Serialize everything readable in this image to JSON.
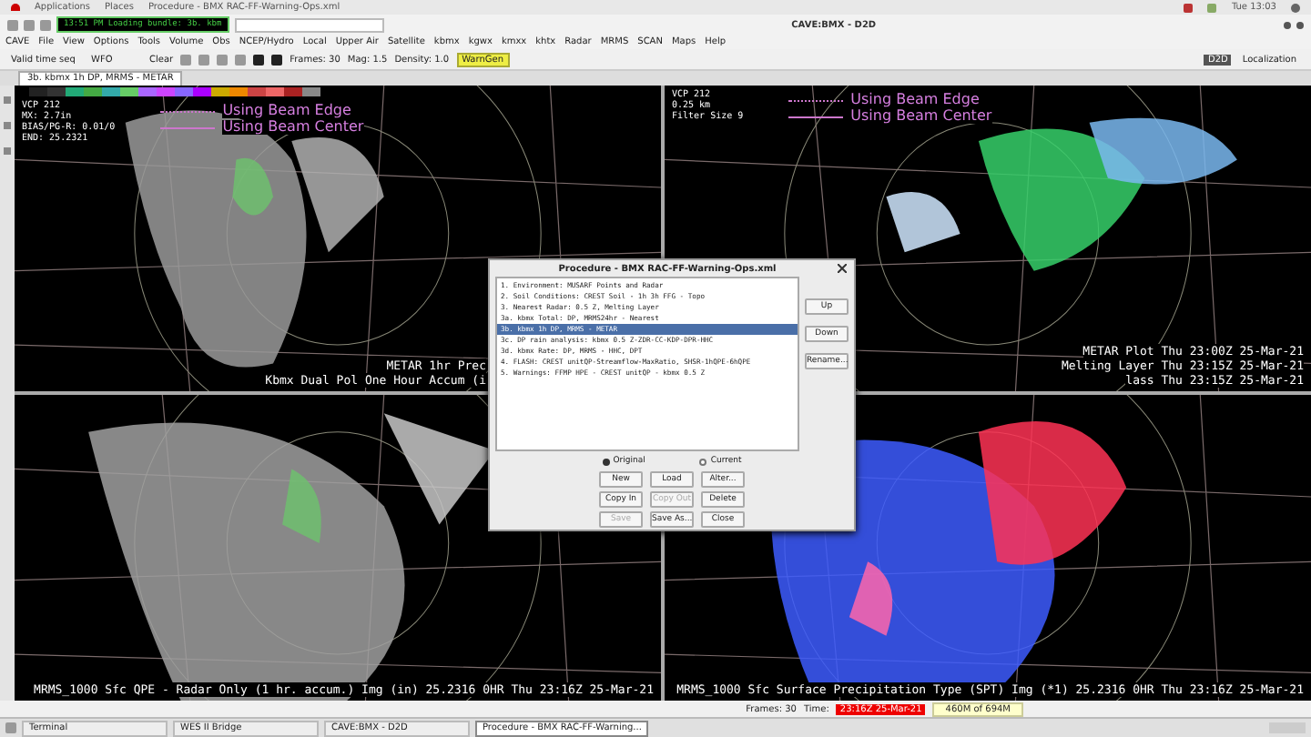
{
  "system_bar": {
    "items": [
      "Applications",
      "Places",
      "Procedure - BMX RAC-FF-Warning-Ops.xml"
    ],
    "clock": "Tue 13:03"
  },
  "window": {
    "title": "CAVE:BMX - D2D",
    "loading_message": "13:51 PM Loading bundle: 3b. kbm"
  },
  "menu": [
    "CAVE",
    "File",
    "View",
    "Options",
    "Tools",
    "Volume",
    "Obs",
    "NCEP/Hydro",
    "Local",
    "Upper Air",
    "Satellite",
    "kbmx",
    "kgwx",
    "kmxx",
    "khtx",
    "Radar",
    "MRMS",
    "SCAN",
    "Maps",
    "Help"
  ],
  "toolbar": {
    "time_mode": "Valid time seq",
    "scale": "WFO",
    "clear": "Clear",
    "frames": "Frames: 30",
    "mag": "Mag: 1.5",
    "density": "Density: 1.0",
    "warngen": "WarnGen",
    "perspectives": [
      {
        "label": "D2D",
        "selected": true
      },
      {
        "label": "Localization",
        "selected": false
      }
    ]
  },
  "editor_tab": "3b. kbmx 1h DP, MRMS - METAR",
  "panels": [
    {
      "kind": "dual-pol-accum",
      "info": [
        "VCP 212",
        "MX: 2.7in",
        "BIAS/PG-R: 0.01/0",
        "END: 25.2321"
      ],
      "legend": [
        "Using Beam Edge",
        "Using Beam Center"
      ],
      "colorbar": true,
      "labels": [
        "METAR 1hr Prec",
        "Kbmx Dual Pol One Hour Accum (i"
      ]
    },
    {
      "kind": "precip-class",
      "info": [
        "VCP 212",
        "0.25 km",
        "Filter Size 9"
      ],
      "legend": [
        "Using Beam Edge",
        "Using Beam Center"
      ],
      "labels": [
        "METAR Plot  Thu 23:00Z 25-Mar-21",
        "Melting Layer  Thu 23:15Z 25-Mar-21",
        "lass  Thu 23:15Z 25-Mar-21"
      ]
    },
    {
      "kind": "mrms-qpe",
      "labels": [
        "MRMS_1000 Sfc QPE - Radar Only (1 hr. accum.) Img (in)   25.2316   0HR Thu 23:16Z 25-Mar-21"
      ]
    },
    {
      "kind": "precip-type",
      "labels": [
        "MRMS_1000 Sfc Surface Precipitation Type (SPT) Img (*1)   25.2316   0HR Thu 23:16Z 25-Mar-21"
      ]
    }
  ],
  "dialog": {
    "title": "Procedure - BMX RAC-FF-Warning-Ops.xml",
    "items": [
      {
        "text": "1. Environment: MUSARF Points and Radar",
        "selected": false
      },
      {
        "text": "2. Soil Conditions: CREST Soil - 1h 3h FFG - Topo",
        "selected": false
      },
      {
        "text": "3. Nearest Radar: 0.5 Z, Melting Layer",
        "selected": false
      },
      {
        "text": "3a. kbmx Total: DP, MRMS24hr - Nearest",
        "selected": false
      },
      {
        "text": "3b. kbmx 1h DP, MRMS - METAR",
        "selected": true
      },
      {
        "text": "3c. DP rain analysis: kbmx 0.5 Z-ZDR-CC-KDP-DPR-HHC",
        "selected": false
      },
      {
        "text": "3d. kbmx Rate: DP, MRMS - HHC, DPT",
        "selected": false
      },
      {
        "text": "4. FLASH: CREST unitQP-Streamflow-MaxRatio, SHSR-1hQPE-6hQPE",
        "selected": false
      },
      {
        "text": "5. Warnings: FFMP HPE - CREST unitQP - kbmx 0.5 Z",
        "selected": false
      }
    ],
    "side_buttons": [
      "Up",
      "Down",
      "Rename..."
    ],
    "options": [
      {
        "label": "Original",
        "selected": true
      },
      {
        "label": "Current",
        "selected": false
      }
    ],
    "buttons": [
      {
        "label": "New",
        "disabled": false
      },
      {
        "label": "Load",
        "disabled": false
      },
      {
        "label": "Alter...",
        "disabled": false
      },
      {
        "label": "Copy In",
        "disabled": false
      },
      {
        "label": "Copy Out",
        "disabled": true
      },
      {
        "label": "Delete",
        "disabled": false
      },
      {
        "label": "Save",
        "disabled": true
      },
      {
        "label": "Save As...",
        "disabled": false
      },
      {
        "label": "Close",
        "disabled": false
      }
    ]
  },
  "status_bar": {
    "frames": "Frames: 30",
    "time_label": "Time:",
    "time": "23:16Z 25-Mar-21",
    "memory": "460M of 694M"
  },
  "taskbar": [
    {
      "label": "Terminal",
      "selected": false
    },
    {
      "label": "WES II Bridge",
      "selected": false
    },
    {
      "label": "CAVE:BMX - D2D",
      "selected": false
    },
    {
      "label": "Procedure - BMX RAC-FF-Warning...",
      "selected": true
    }
  ]
}
